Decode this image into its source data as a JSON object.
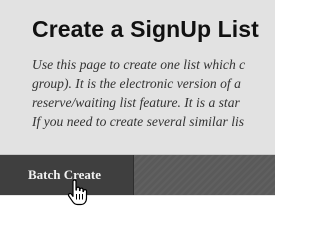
{
  "header": {
    "title": "Create a SignUp List",
    "description_lines": [
      "Use this page to create one list which c",
      "group). It is the electronic version of a",
      "reserve/waiting list feature. It is a star",
      "If you need to create several similar lis"
    ]
  },
  "action_bar": {
    "batch_create_label": "Batch Create"
  },
  "cursor": {
    "icon": "hand-pointer-icon"
  }
}
